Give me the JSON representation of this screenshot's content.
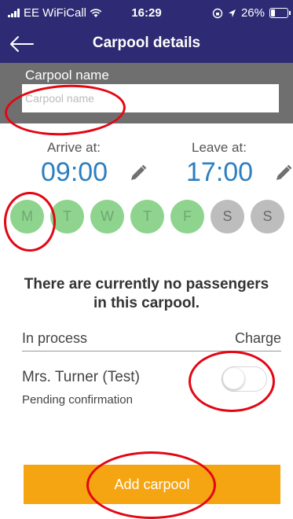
{
  "status_bar": {
    "carrier": "EE WiFiCall",
    "time": "16:29",
    "battery_text": "26%",
    "battery_level": 0.26,
    "icons": [
      "signal-icon",
      "wifi-icon",
      "rotation-lock-icon",
      "location-icon",
      "battery-icon"
    ]
  },
  "nav": {
    "title": "Carpool details",
    "back_icon": "back-arrow-icon"
  },
  "name_field": {
    "label": "Carpool name",
    "value": "",
    "placeholder": "Carpool name"
  },
  "schedule": {
    "arrive_label": "Arrive at:",
    "arrive_time": "09:00",
    "leave_label": "Leave at:",
    "leave_time": "17:00",
    "edit_icon": "pencil-icon"
  },
  "days": [
    {
      "label": "M",
      "active": true
    },
    {
      "label": "T",
      "active": true
    },
    {
      "label": "W",
      "active": true
    },
    {
      "label": "T",
      "active": true
    },
    {
      "label": "F",
      "active": true
    },
    {
      "label": "S",
      "active": false
    },
    {
      "label": "S",
      "active": false
    }
  ],
  "passengers_message": "There are currently no passengers in this carpool.",
  "list_header": {
    "left": "In process",
    "right": "Charge"
  },
  "passenger": {
    "name": "Mrs. Turner (Test)",
    "status": "Pending confirmation",
    "charge_on": false
  },
  "add_button": "Add carpool",
  "colors": {
    "header_bg": "#2e2a73",
    "name_section_bg": "#6f6f6f",
    "time_blue": "#2c7fc1",
    "day_active": "#8ed48f",
    "day_inactive": "#bdbdbd",
    "button_orange": "#f5a412",
    "annotation_red": "#e30613"
  }
}
